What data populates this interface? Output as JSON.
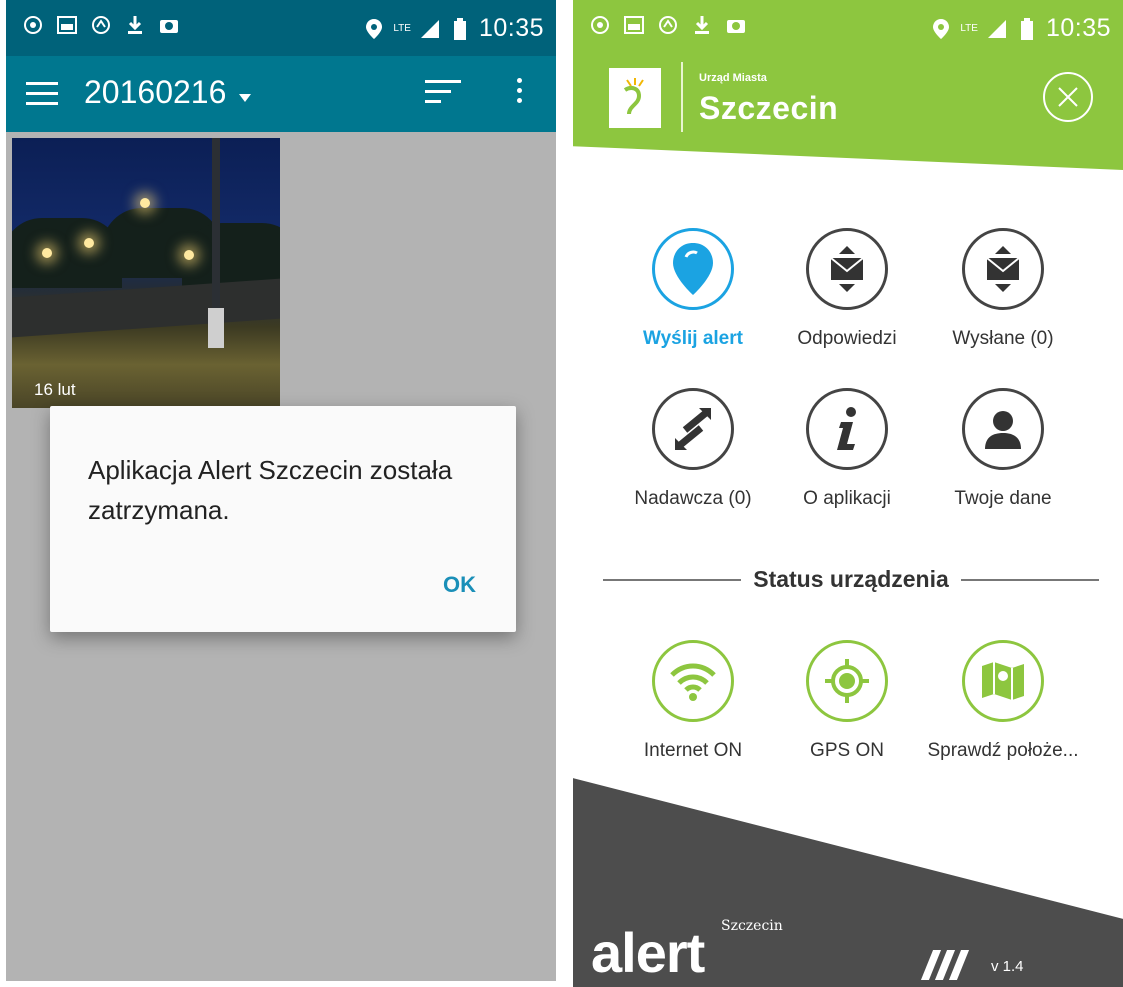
{
  "left_screen": {
    "status_bar": {
      "time": "10:35",
      "network_label": "LTE",
      "left_icons": [
        "whatsapp-icon",
        "image-icon",
        "sync-icon",
        "download-icon",
        "camera-icon"
      ],
      "right_icons": [
        "location-icon",
        "signal-icon",
        "battery-icon"
      ]
    },
    "toolbar": {
      "title": "20160216",
      "background": "#00778f"
    },
    "gallery": {
      "photo_date": "16 lut"
    },
    "dialog": {
      "message": "Aplikacja Alert Szczecin została zatrzymana.",
      "ok_label": "OK"
    }
  },
  "right_screen": {
    "status_bar": {
      "time": "10:35",
      "network_label": "LTE"
    },
    "header": {
      "subtitle": "Urząd Miasta",
      "title": "Szczecin",
      "accent": "#8dc63f"
    },
    "menu": [
      {
        "label": "Wyślij alert",
        "icon": "map-pin-icon"
      },
      {
        "label": "Odpowiedzi",
        "icon": "mail-in-icon"
      },
      {
        "label": "Wysłane (0)",
        "icon": "mail-out-icon"
      },
      {
        "label": "Nadawcza (0)",
        "icon": "outbox-arrows-icon"
      },
      {
        "label": "O aplikacji",
        "icon": "info-icon"
      },
      {
        "label": "Twoje dane",
        "icon": "user-icon"
      }
    ],
    "status_heading": "Status urządzenia",
    "status_items": [
      {
        "label": "Internet ON",
        "icon": "wifi-icon"
      },
      {
        "label": "GPS ON",
        "icon": "gps-icon"
      },
      {
        "label": "Sprawdź położe...",
        "icon": "map-icon"
      }
    ],
    "footer": {
      "logo": "alert",
      "logo_sup": "Szczecin",
      "version": "v 1.4"
    }
  }
}
